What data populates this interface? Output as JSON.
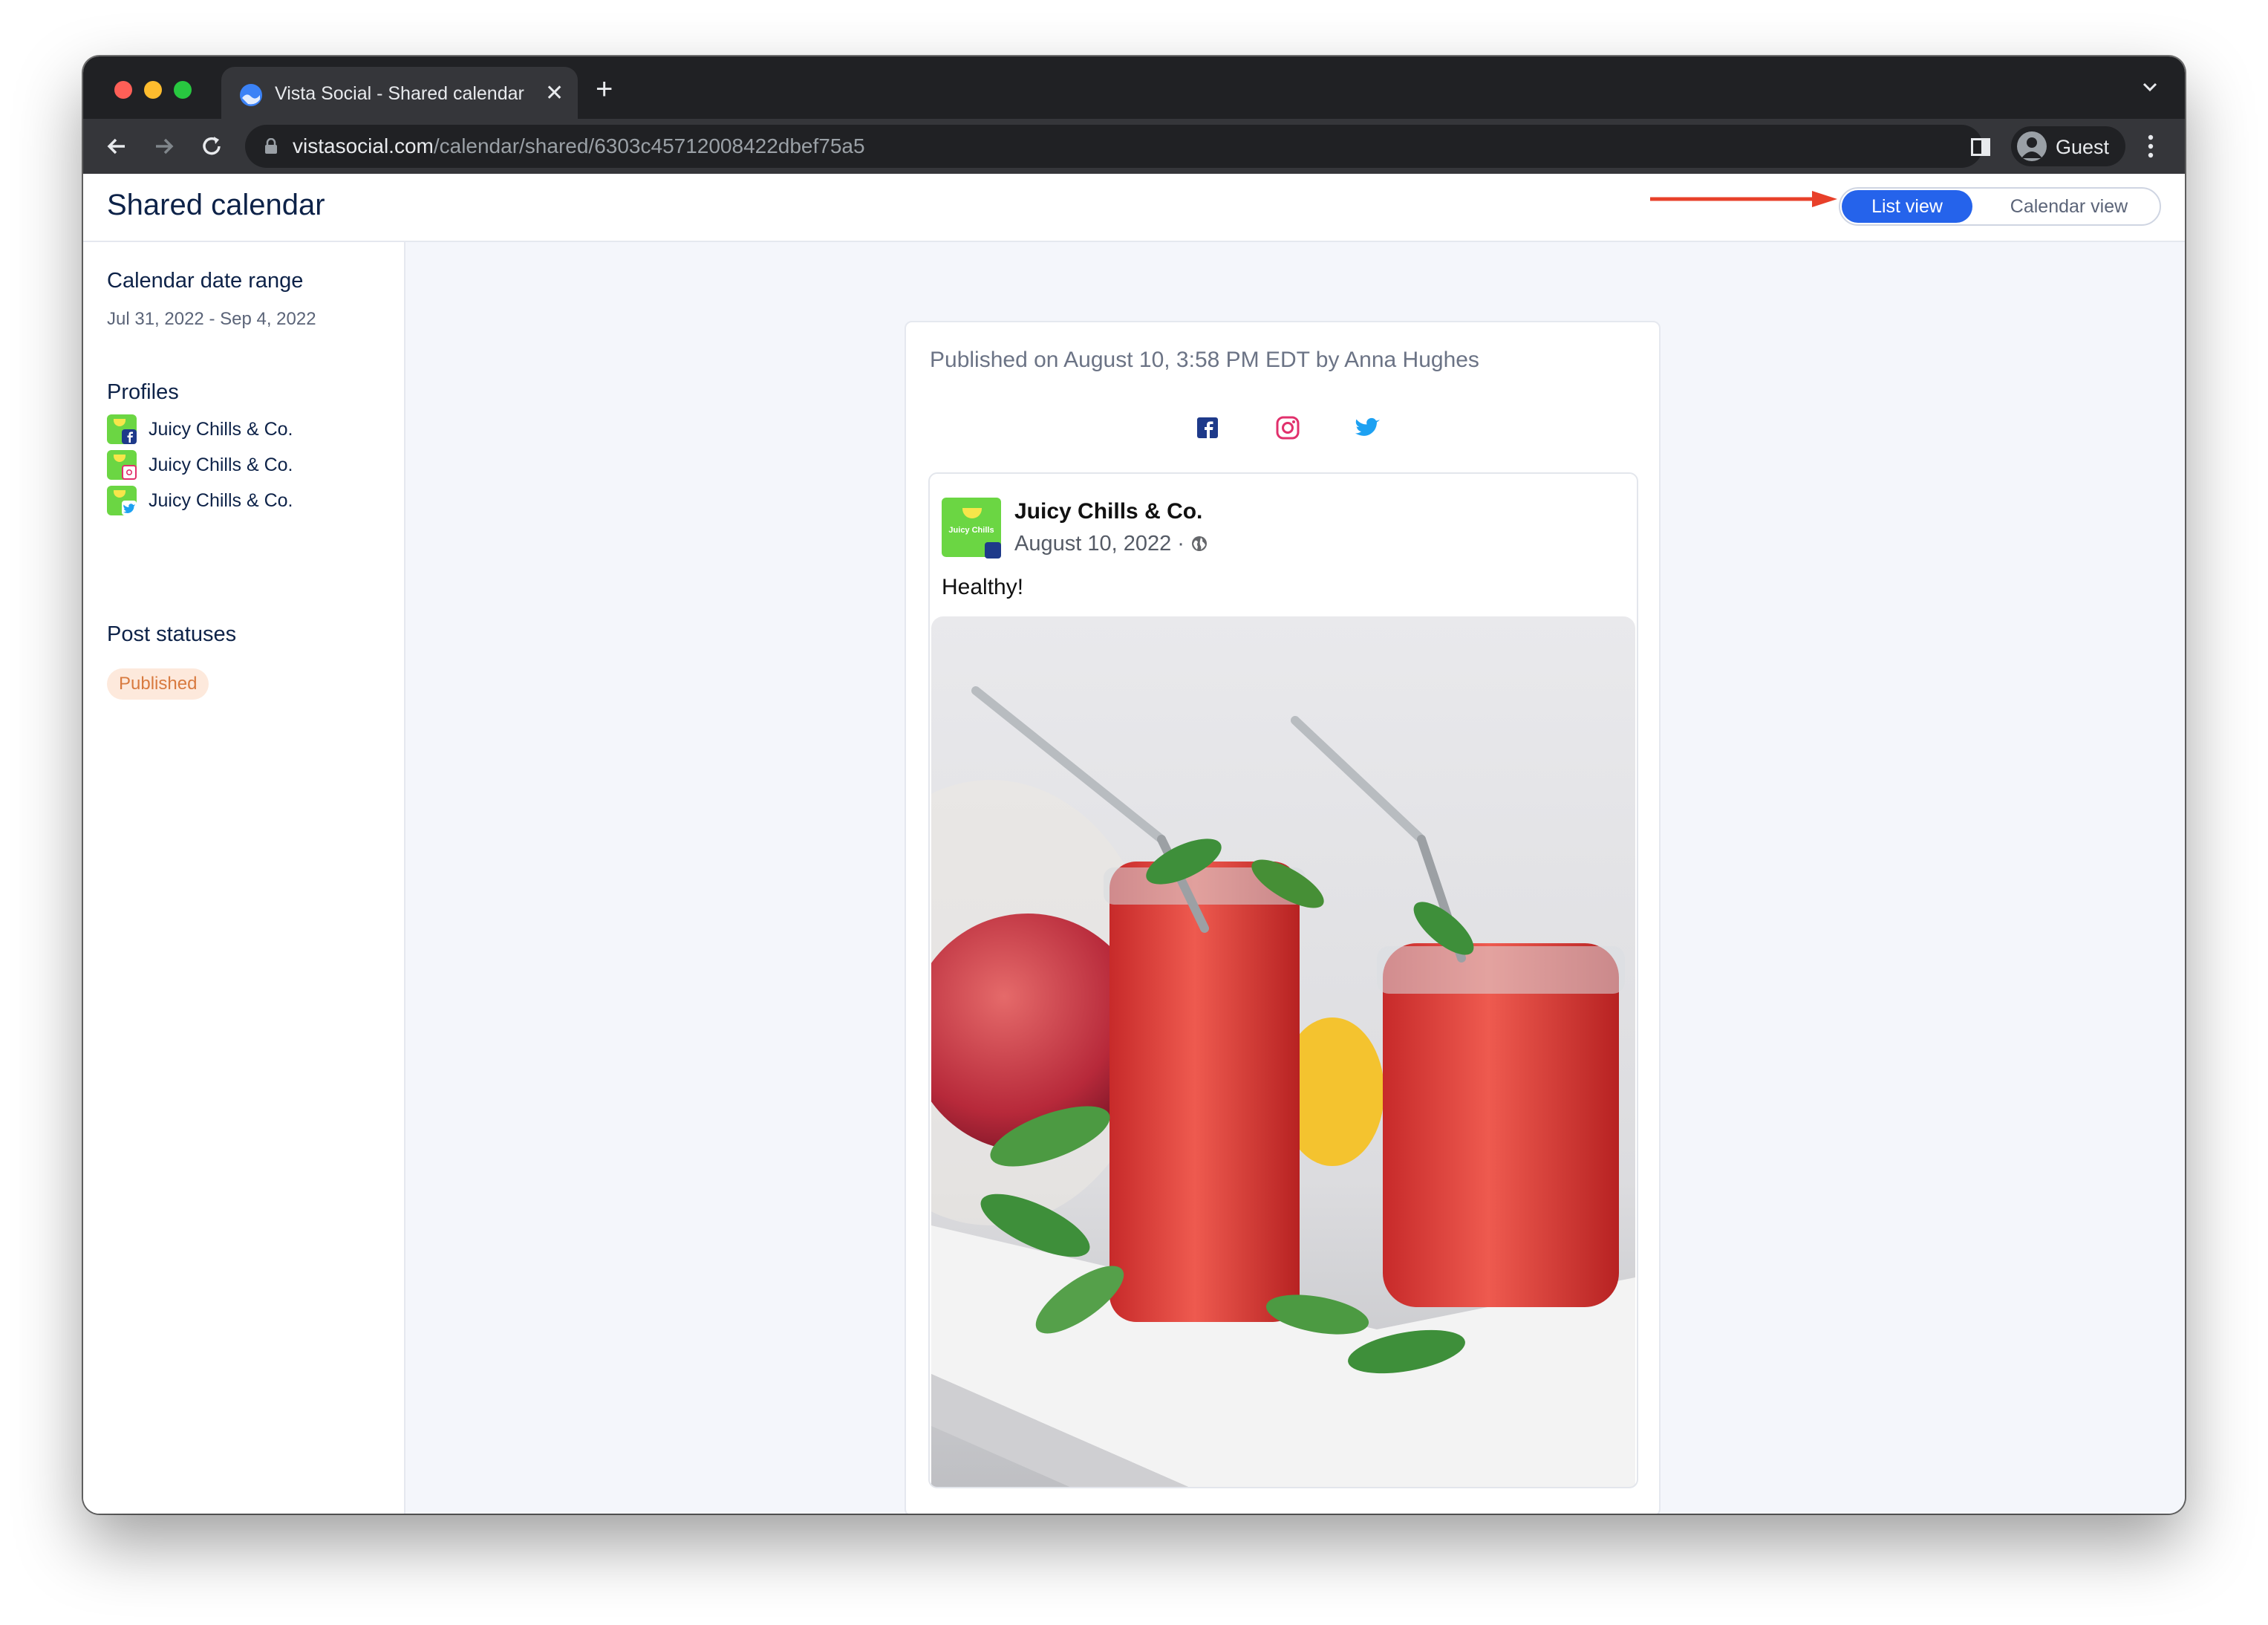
{
  "browser": {
    "tab_title": "Vista Social - Shared calendar",
    "url_host": "vistasocial.com",
    "url_path": "/calendar/shared/6303c45712008422dbef75a5",
    "profile_name": "Guest"
  },
  "page": {
    "title": "Shared calendar",
    "view_toggle": {
      "list": "List view",
      "calendar": "Calendar view",
      "active": "List view"
    }
  },
  "sidebar": {
    "date_range_heading": "Calendar date range",
    "date_range": "Jul 31, 2022 - Sep 4, 2022",
    "profiles_heading": "Profiles",
    "profiles": [
      {
        "name": "Juicy Chills & Co.",
        "network_icon": "facebook-icon"
      },
      {
        "name": "Juicy Chills & Co.",
        "network_icon": "instagram-icon"
      },
      {
        "name": "Juicy Chills & Co.",
        "network_icon": "twitter-icon"
      }
    ],
    "post_statuses_heading": "Post statuses",
    "status_badge": "Published"
  },
  "post": {
    "published_line": "Published on August 10, 3:58 PM EDT by Anna Hughes",
    "networks": [
      "facebook-icon",
      "instagram-icon",
      "twitter-icon"
    ],
    "active_network": "facebook-icon",
    "preview": {
      "account_name": "Juicy Chills & Co.",
      "date": "August 10, 2022 ·",
      "text": "Healthy!",
      "logo_text": "Juicy Chills",
      "image_icon": "smoothie-jars-photo"
    }
  },
  "colors": {
    "accent": "#2563eb",
    "title": "#0d2248",
    "badge_bg": "#fde9dc",
    "badge_text": "#d87a3f",
    "facebook": "#1e3a8a",
    "instagram": "#e1306c",
    "twitter": "#1da1f2",
    "annotation_arrow": "#e8402a"
  }
}
